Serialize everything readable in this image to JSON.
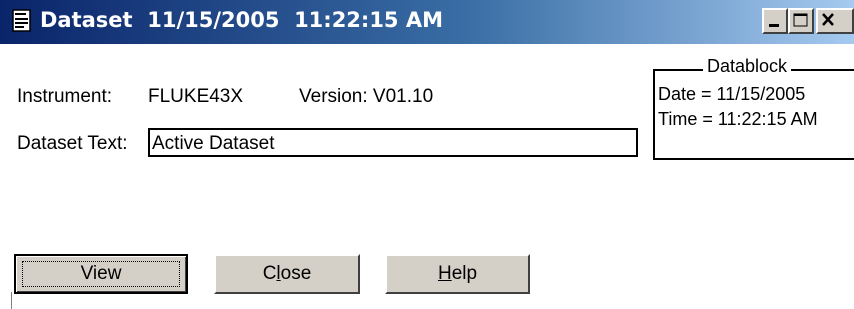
{
  "window": {
    "title": "Dataset  11/15/2005  11:22:15 AM"
  },
  "instrument": {
    "label": "Instrument:",
    "value": "FLUKE43X",
    "version": "Version: V01.10"
  },
  "dataset_text": {
    "label": "Dataset Text:",
    "value": "Active Dataset"
  },
  "datablock": {
    "legend": "Datablock",
    "date_line": "Date = 11/15/2005",
    "time_line": "Time = 11:22:15 AM"
  },
  "buttons": {
    "view": "View",
    "close_prefix": "C",
    "close_mnemonic": "l",
    "close_suffix": "ose",
    "help_mnemonic": "H",
    "help_suffix": "elp"
  },
  "icons": {
    "window_icon": "document-icon",
    "minimize": "minimize-icon",
    "maximize": "maximize-icon",
    "close": "close-icon"
  },
  "colors": {
    "titlebar_start": "#0a246a",
    "titlebar_end": "#a6caf0",
    "button_face": "#d4d0c8"
  }
}
